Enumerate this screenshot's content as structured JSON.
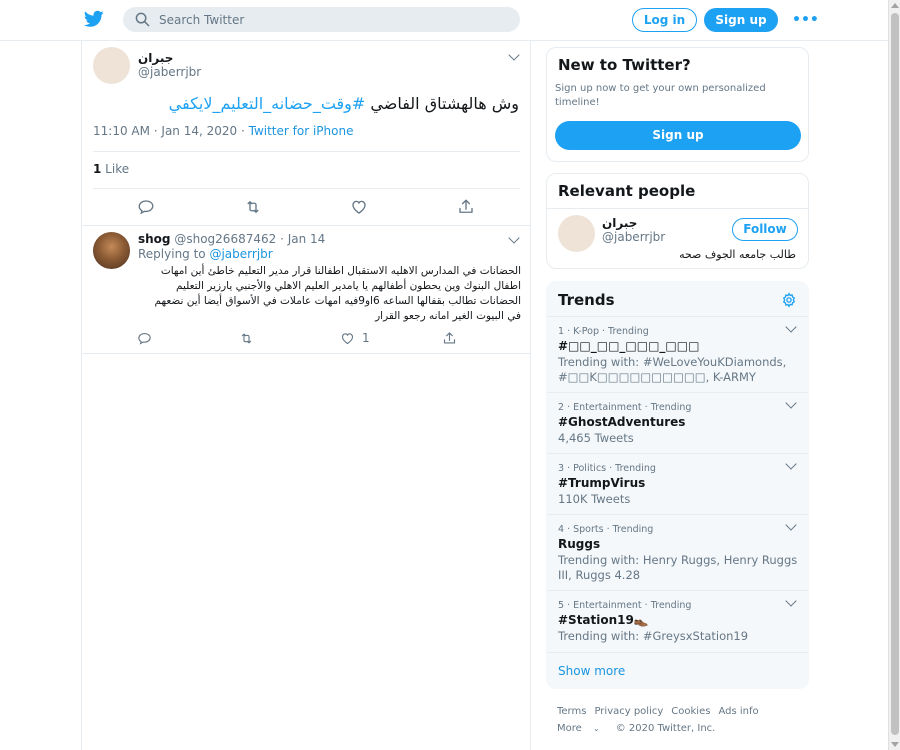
{
  "header": {
    "search_placeholder": "Search Twitter",
    "login_label": "Log in",
    "signup_label": "Sign up",
    "more_label": "•••"
  },
  "tweet": {
    "author_name": "جبران",
    "author_handle": "@jaberrjbr",
    "text_prefix": "وش هالهشتاق الفاضي ",
    "hashtag": "#وقت_حضانه_التعليم_لايكفي",
    "timestamp": "11:10 AM · Jan 14, 2020 · ",
    "source": "Twitter for iPhone",
    "like_count": "1",
    "like_label": " Like"
  },
  "reply": {
    "author_name": "shog",
    "author_handle": "@shog26687462",
    "date": "· Jan 14",
    "replying_prefix": "Replying to ",
    "replying_to": "@jaberrjbr",
    "text": "الحضانات في المدارس الاهليه الاستقبال اطفالنا قرار مدير التعليم خاطئ أين امهات اطفال البنوك وين يحطون أطفالهم يا يامدير العليم الاهلي والأجنبي يارزير التعليم الحضانات تطالب بقفالها الساعه 6او9فيه امهات عاملات في الأسواق أيضا أين نضعهم في البيوت الغير امانه  رجعو القرار",
    "like_count": "1"
  },
  "new_to_twitter": {
    "title": "New to Twitter?",
    "description": "Sign up now to get your own personalized timeline!",
    "signup_label": "Sign up"
  },
  "relevant_people": {
    "title": "Relevant people",
    "name": "جبران",
    "handle": "@jaberrjbr",
    "follow_label": "Follow",
    "bio": "طالب جامعه الجوف صحه"
  },
  "trends": {
    "title": "Trends",
    "items": [
      {
        "meta": "1 · K-Pop · Trending",
        "name": "#□□_□□_□□□_□□□",
        "sub": "Trending with: #WeLoveYouKDiamonds, #□□K□□□□□□□□□□, K-ARMY"
      },
      {
        "meta": "2 · Entertainment · Trending",
        "name": "#GhostAdventures",
        "sub": "4,465 Tweets"
      },
      {
        "meta": "3 · Politics · Trending",
        "name": "#TrumpVirus",
        "sub": "110K Tweets"
      },
      {
        "meta": "4 · Sports · Trending",
        "name": "Ruggs",
        "sub": "Trending with: Henry Ruggs, Henry Ruggs III, Ruggs 4.28"
      },
      {
        "meta": "5 · Entertainment · Trending",
        "name": "#Station19👞",
        "sub": "Trending with: #GreysxStation19"
      }
    ],
    "show_more": "Show more"
  },
  "footer": {
    "terms": "Terms",
    "privacy": "Privacy policy",
    "cookies": "Cookies",
    "ads": "Ads info",
    "more": "More",
    "copyright": "© 2020 Twitter, Inc."
  },
  "colors": {
    "accent": "#1da1f2",
    "link": "#1b95e0",
    "muted": "#657786",
    "border": "#e6ecf0"
  }
}
